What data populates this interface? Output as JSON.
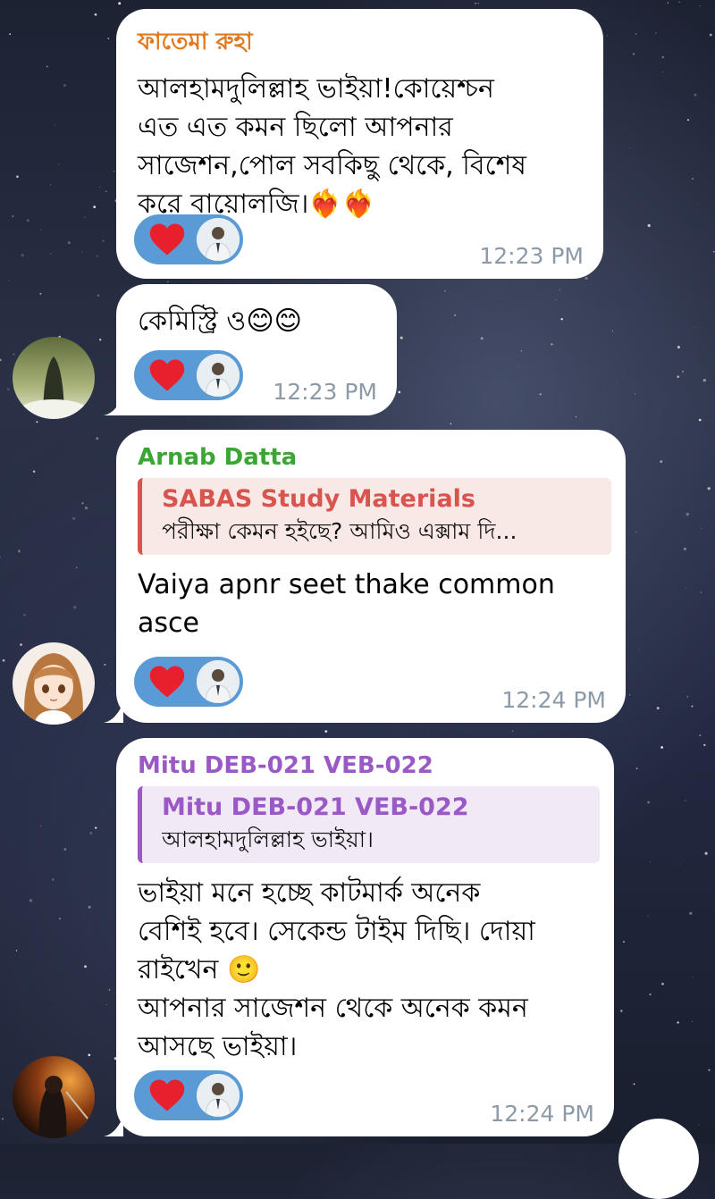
{
  "messages": [
    {
      "sender": "ফাতেমা রুহা",
      "sender_color": "#e07a1f",
      "text": "আলহামদুলিল্লাহ ভাইয়া!কোয়েশ্চন\nএত এত কমন ছিলো আপনার\nসাজেশন,পোল সবকিছু থেকে, বিশেষ\nকরে বায়োলজি।❤️‍🔥❤️‍🔥",
      "reaction": "heart",
      "time": "12:23 PM"
    },
    {
      "text": "কেমিস্ট্রি ও😊😊",
      "reaction": "heart",
      "time": "12:23 PM"
    },
    {
      "sender": "Arnab Datta",
      "sender_color": "#3ba633",
      "reply": {
        "name": "SABAS Study Materials",
        "text": "পরীক্ষা কেমন হইছে?  আমিও এক্সাম দি...",
        "color": "#d9534f",
        "bg": "#f8e8e6"
      },
      "text": "Vaiya apnr seet thake common\nasce",
      "reaction": "heart",
      "time": "12:24 PM"
    },
    {
      "sender": "Mitu DEB-021 VEB-022",
      "sender_color": "#9b59c6",
      "reply": {
        "name": "Mitu DEB-021 VEB-022",
        "text": "আলহামদুলিল্লাহ ভাইয়া।",
        "color": "#9b59c6",
        "bg": "#f1eaf6"
      },
      "text": "ভাইয়া মনে হচ্ছে কাটমার্ক অনেক\nবেশিই হবে। সেকেন্ড টাইম দিছি। দোয়া\nরাইখেন 🙂\nআপনার সাজেশন থেকে অনেক কমন\nআসছে ভাইয়া।",
      "reaction": "heart",
      "time": "12:24 PM"
    }
  ],
  "colors": {
    "reaction_bg": "#5b9bd5",
    "heart": "#e8202e",
    "time": "#8c9aa8",
    "bubble": "#ffffff"
  }
}
